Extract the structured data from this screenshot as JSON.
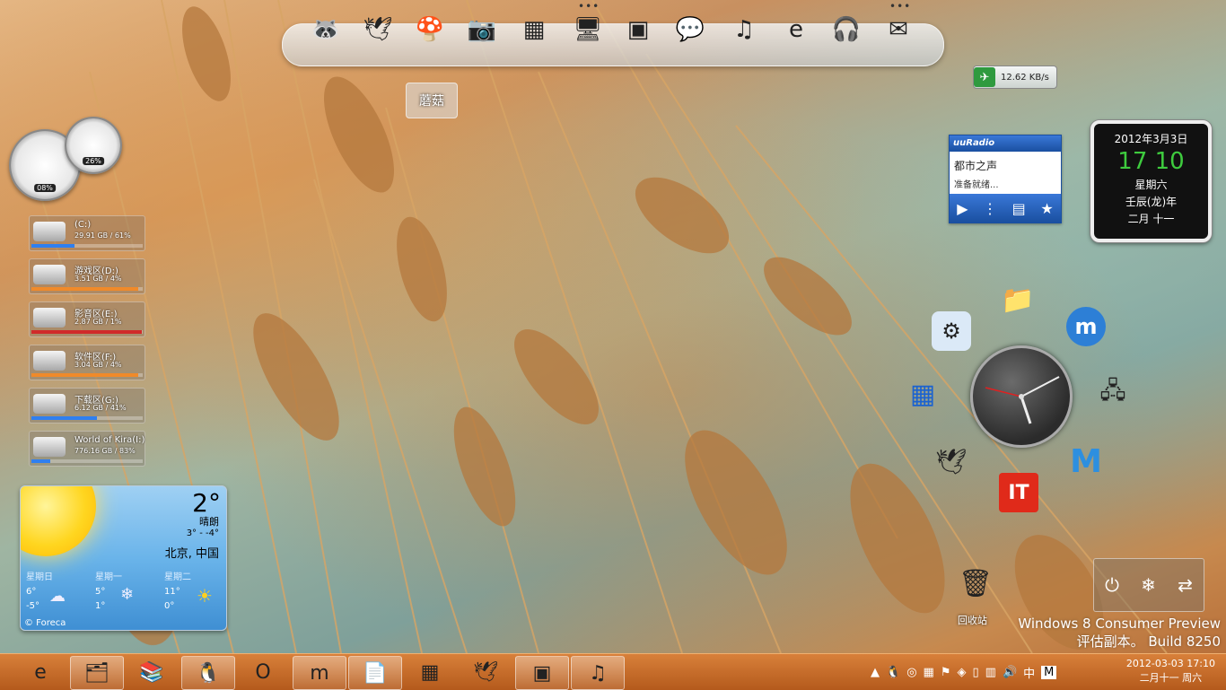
{
  "dock": {
    "items": [
      {
        "name": "yy-icon",
        "glyph": "🦝"
      },
      {
        "name": "feiq-bird-icon",
        "glyph": "🕊"
      },
      {
        "name": "mushroom-icon",
        "glyph": "🍄"
      },
      {
        "name": "webcam-icon",
        "glyph": "📷"
      },
      {
        "name": "cube-icon",
        "glyph": "▦"
      },
      {
        "name": "computer-icon",
        "glyph": "🖥"
      },
      {
        "name": "flashget-icon",
        "glyph": "▣"
      },
      {
        "name": "chat-bubble-icon",
        "glyph": "💬"
      },
      {
        "name": "itunes-icon",
        "glyph": "♫"
      },
      {
        "name": "ie-icon",
        "glyph": "e"
      },
      {
        "name": "headphone-icon",
        "glyph": "🎧"
      },
      {
        "name": "mail-icon",
        "glyph": "✉"
      }
    ],
    "tooltip": "蘑菇"
  },
  "netspeed": {
    "value": "12.62 KB/s"
  },
  "gauges": {
    "cpu": "08%",
    "mem": "26%"
  },
  "drives": [
    {
      "name": "(C:)",
      "info": "29.91 GB / 61%",
      "usage": 0.39,
      "color": "#2f7ff0"
    },
    {
      "name": "游戏区(D:)",
      "info": "3.51 GB / 4%",
      "usage": 0.96,
      "color": "#f08a2a"
    },
    {
      "name": "影音区(E:)",
      "info": "2.87 GB / 1%",
      "usage": 0.99,
      "color": "#d02a2a"
    },
    {
      "name": "软件区(F:)",
      "info": "3.04 GB / 4%",
      "usage": 0.96,
      "color": "#f08a2a"
    },
    {
      "name": "下载区(G:)",
      "info": "6.12 GB / 41%",
      "usage": 0.59,
      "color": "#2f7ff0"
    },
    {
      "name": "World of Kira(I:)",
      "info": "776.16 GB / 83%",
      "usage": 0.17,
      "color": "#2f7ff0"
    }
  ],
  "weather": {
    "temp": "2°",
    "condition": "晴朗",
    "range": "3° - -4°",
    "city": "北京, 中国",
    "days": [
      {
        "name": "星期日",
        "hi": "6°",
        "lo": "-5°",
        "icon": "☁"
      },
      {
        "name": "星期一",
        "hi": "5°",
        "lo": "1°",
        "icon": "❄"
      },
      {
        "name": "星期二",
        "hi": "11°",
        "lo": "0°",
        "icon": "☀"
      }
    ],
    "credit": "© Foreca"
  },
  "radio": {
    "title": "uuRadio",
    "station": "都市之声",
    "status": "准备就绪..."
  },
  "calendar": {
    "date": "2012年3月3日",
    "time": "17 10",
    "weekday": "星期六",
    "year": "壬辰(龙)年",
    "lunar": "二月 十一"
  },
  "desktop": {
    "recycle_label": "回收站"
  },
  "watermark": {
    "line1": "Windows 8 Consumer Preview",
    "line2": "评估副本。 Build 8250"
  },
  "taskbar": {
    "items": [
      {
        "name": "ie",
        "glyph": "e",
        "open": false
      },
      {
        "name": "explorer",
        "glyph": "🗂",
        "open": true
      },
      {
        "name": "winrar",
        "glyph": "📚",
        "open": false
      },
      {
        "name": "qq",
        "glyph": "🐧",
        "open": true
      },
      {
        "name": "opera",
        "glyph": "O",
        "open": false
      },
      {
        "name": "maxthon",
        "glyph": "m",
        "open": true
      },
      {
        "name": "document",
        "glyph": "📄",
        "open": true
      },
      {
        "name": "cube",
        "glyph": "▦",
        "open": false
      },
      {
        "name": "bird",
        "glyph": "🕊",
        "open": false
      },
      {
        "name": "flashget",
        "glyph": "▣",
        "open": true
      },
      {
        "name": "itunes",
        "glyph": "♫",
        "open": true
      }
    ],
    "tray": {
      "ime": "中",
      "ime2": "M"
    },
    "clock": {
      "time": "2012-03-03  17:10",
      "date": "二月十一  周六"
    }
  }
}
